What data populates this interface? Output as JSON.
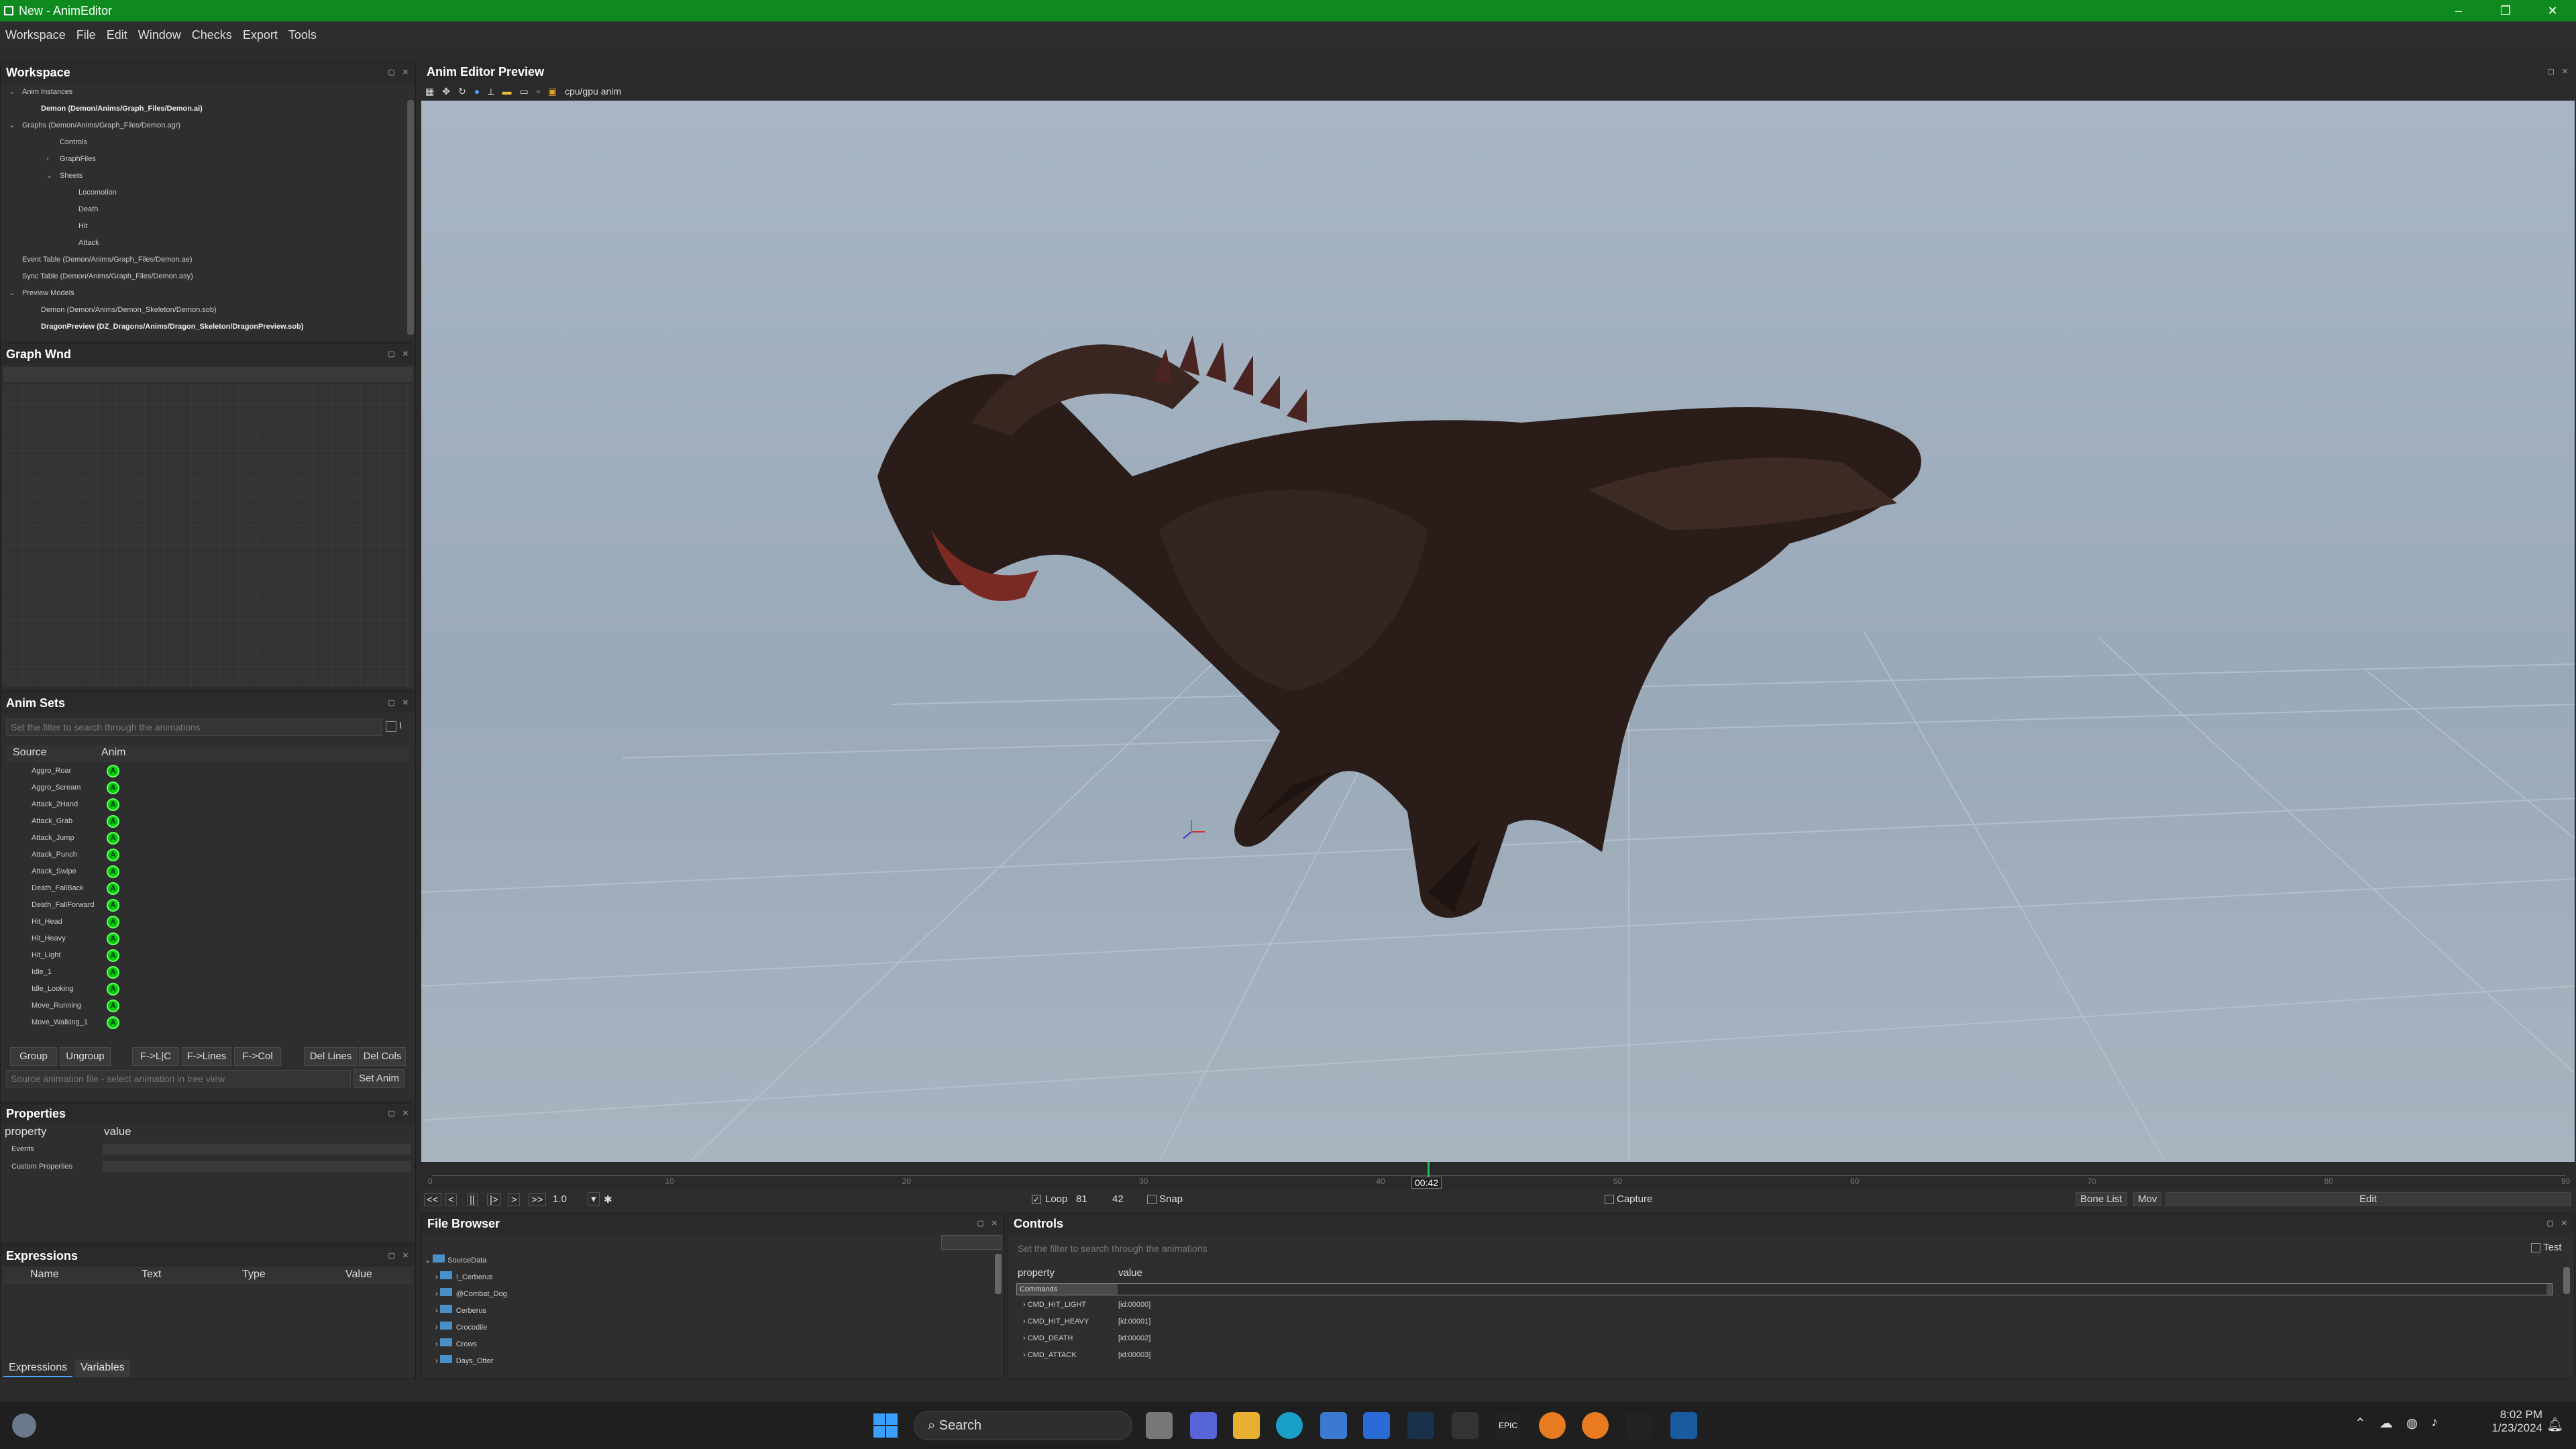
{
  "window": {
    "title": "New - AnimEditor",
    "controls": [
      "–",
      "❐",
      "✕"
    ]
  },
  "menu": [
    "Workspace",
    "File",
    "Edit",
    "Window",
    "Checks",
    "Export",
    "Tools"
  ],
  "workspace": {
    "title": "Workspace",
    "items": [
      {
        "label": "Anim Instances",
        "indent": 0,
        "arrow": "v"
      },
      {
        "label": "Demon (Demon/Anims/Graph_Files/Demon.ai)",
        "indent": 1,
        "bold": true
      },
      {
        "label": "Graphs (Demon/Anims/Graph_Files/Demon.agr)",
        "indent": 0,
        "arrow": "v"
      },
      {
        "label": "Controls",
        "indent": 2
      },
      {
        "label": "GraphFiles",
        "indent": 2,
        "arrow": ">"
      },
      {
        "label": "Sheets",
        "indent": 2,
        "arrow": "v"
      },
      {
        "label": "Locomotion",
        "indent": 3
      },
      {
        "label": "Death",
        "indent": 3
      },
      {
        "label": "Hit",
        "indent": 3
      },
      {
        "label": "Attack",
        "indent": 3
      },
      {
        "label": "Event Table (Demon/Anims/Graph_Files/Demon.ae)",
        "indent": 0
      },
      {
        "label": "Sync Table (Demon/Anims/Graph_Files/Demon.asy)",
        "indent": 0
      },
      {
        "label": "Preview Models",
        "indent": 0,
        "arrow": "v"
      },
      {
        "label": "Demon (Demon/Anims/Demon_Skeleton/Demon.sob)",
        "indent": 1
      },
      {
        "label": "DragonPreview (DZ_Dragons/Anims/Dragon_Skeleton/DragonPreview.sob)",
        "indent": 1,
        "bold": true
      }
    ]
  },
  "graph_wnd": {
    "title": "Graph Wnd"
  },
  "anim_sets": {
    "title": "Anim Sets",
    "filter_placeholder": "Set the filter to search through the animations",
    "filter_check": "I",
    "col_source": "Source",
    "col_anim": "Anim",
    "anim_badge": "A",
    "rows": [
      "Aggro_Roar",
      "Aggro_Scream",
      "Attack_2Hand",
      "Attack_Grab",
      "Attack_Jump",
      "Attack_Punch",
      "Attack_Swipe",
      "Death_FallBack",
      "Death_FallForward",
      "Hit_Head",
      "Hit_Heavy",
      "Hit_Light",
      "Idle_1",
      "Idle_Looking",
      "Move_Running",
      "Move_Walking_1"
    ],
    "buttons": [
      "Group",
      "Ungroup",
      "F->L|C",
      "F->Lines",
      "F->Col",
      "Del Lines",
      "Del Cols"
    ],
    "source_placeholder": "Source animation file - select animation in tree view",
    "set_anim": "Set Anim"
  },
  "properties": {
    "title": "Properties",
    "col_property": "property",
    "col_value": "value",
    "rows": [
      "Events",
      "Custom Properties"
    ]
  },
  "expressions": {
    "title": "Expressions",
    "cols": [
      "Name",
      "Text",
      "Type",
      "Value"
    ],
    "tabs": [
      "Expressions",
      "Variables"
    ]
  },
  "preview": {
    "title": "Anim Editor Preview",
    "toolbar_text": "cpu/gpu anim",
    "timeline_ticks": [
      "0",
      "10",
      "20",
      "30",
      "40",
      "50",
      "60",
      "70",
      "80",
      "90"
    ],
    "timeline_max": 90,
    "current_frame_label": "00:42",
    "current_frame": 42,
    "speed": "1.0",
    "loop_label": "Loop",
    "loop_value": "81",
    "frame_value": "42",
    "snap_label": "Snap",
    "capture_label": "Capture",
    "bone_list": "Bone List",
    "mov": "Mov",
    "edit": "Edit",
    "transport": [
      "<<",
      "<",
      "||",
      "|>",
      ">",
      ">>"
    ]
  },
  "file_browser": {
    "title": "File Browser",
    "root": "SourceData",
    "items": [
      "!_Cerberus",
      "@Combat_Dog",
      "Cerberus",
      "Crocodile",
      "Crows",
      "Days_Otter"
    ]
  },
  "controls": {
    "title": "Controls",
    "filter_placeholder": "Set the filter to search through the animations",
    "test_label": "Test",
    "col_property": "property",
    "col_value": "value",
    "group": "Commands",
    "rows": [
      {
        "name": "CMD_HIT_LIGHT",
        "value": "[id:00000]"
      },
      {
        "name": "CMD_HIT_HEAVY",
        "value": "[id:00001]"
      },
      {
        "name": "CMD_DEATH",
        "value": "[id:00002]"
      },
      {
        "name": "CMD_ATTACK",
        "value": "[id:00003]"
      }
    ]
  },
  "taskbar": {
    "search": "Search",
    "time": "8:02 PM",
    "date": "1/23/2024"
  }
}
